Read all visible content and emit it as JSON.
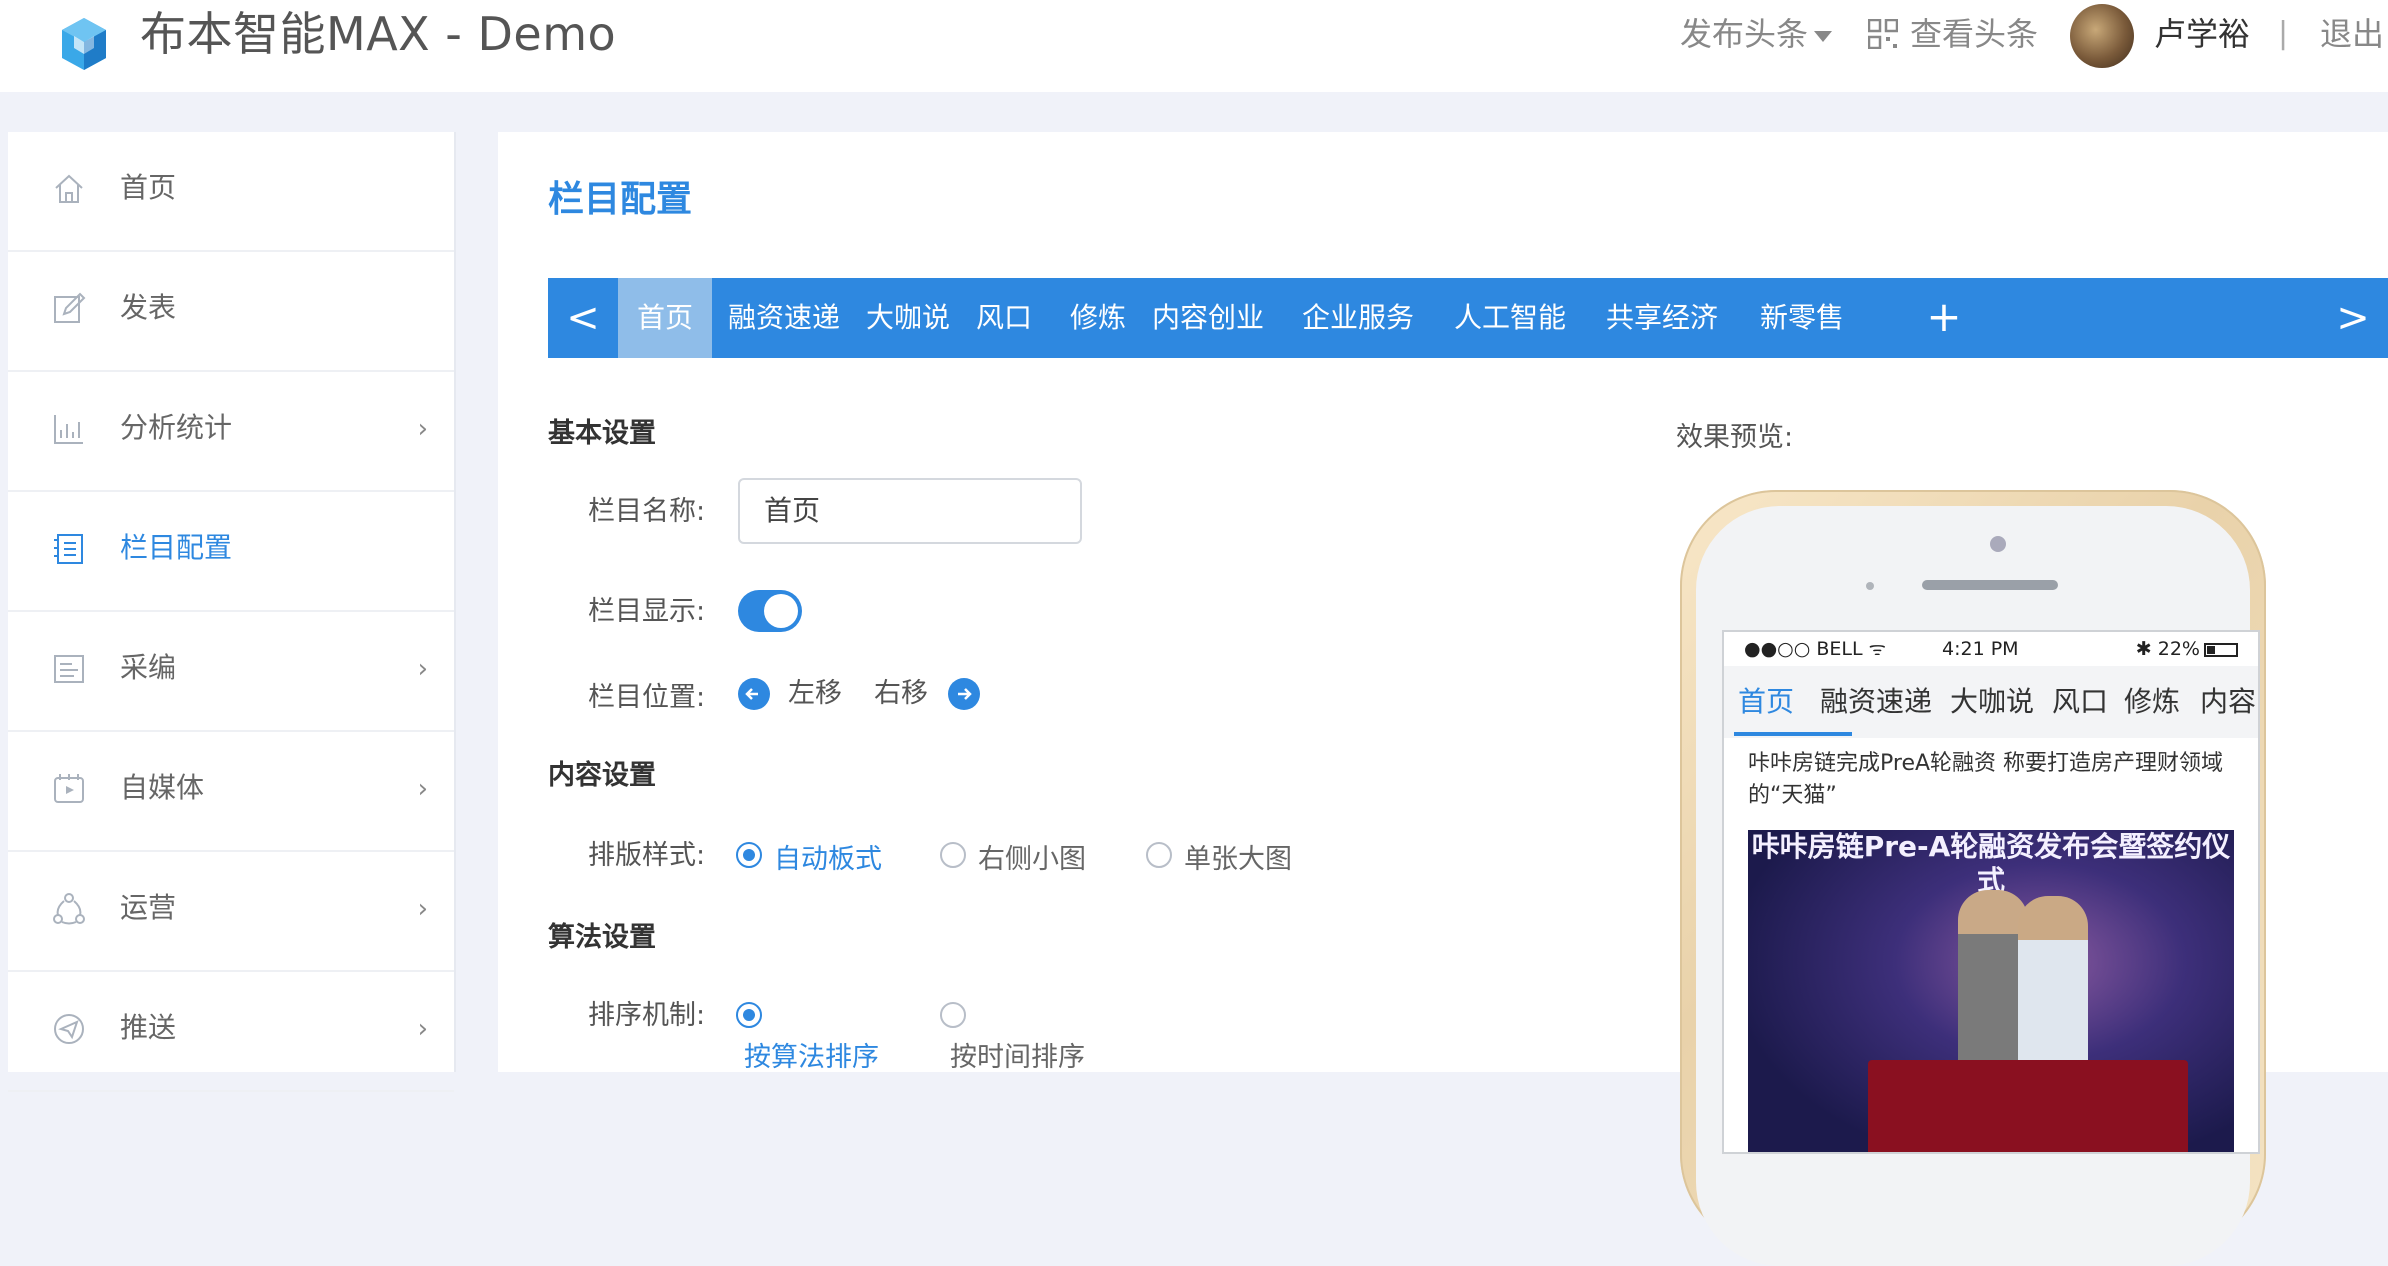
{
  "header": {
    "app_title": "布本智能MAX - Demo",
    "publish_label": "发布头条",
    "view_label": "查看头条",
    "user_name": "卢学裕",
    "separator": "|",
    "logout_label": "退出"
  },
  "sidebar": {
    "items": [
      {
        "label": "首页",
        "icon": "home-icon",
        "arrow": ""
      },
      {
        "label": "发表",
        "icon": "edit-icon",
        "arrow": ""
      },
      {
        "label": "分析统计",
        "icon": "chart-icon",
        "arrow": "›"
      },
      {
        "label": "栏目配置",
        "icon": "list-icon",
        "arrow": ""
      },
      {
        "label": "采编",
        "icon": "collect-icon",
        "arrow": "›"
      },
      {
        "label": "自媒体",
        "icon": "media-icon",
        "arrow": "›"
      },
      {
        "label": "运营",
        "icon": "share-icon",
        "arrow": "›"
      },
      {
        "label": "推送",
        "icon": "send-icon",
        "arrow": "›"
      }
    ]
  },
  "main": {
    "page_title": "栏目配置",
    "tabs": {
      "prev": "<",
      "next": ">",
      "add": "+",
      "items": [
        "首页",
        "融资速递",
        "大咖说",
        "风口",
        "修炼",
        "内容创业",
        "企业服务",
        "人工智能",
        "共享经济",
        "新零售"
      ]
    },
    "basic": {
      "title": "基本设置",
      "name_label": "栏目名称:",
      "name_value": "首页",
      "display_label": "栏目显示:",
      "position_label": "栏目位置:",
      "move_left": "左移",
      "move_right": "右移"
    },
    "content": {
      "title": "内容设置",
      "layout_label": "排版样式:",
      "options": [
        "自动板式",
        "右侧小图",
        "单张大图"
      ]
    },
    "algorithm": {
      "title": "算法设置",
      "sort_label": "排序机制:",
      "options": [
        "按算法排序",
        "按时间排序"
      ]
    },
    "preview": {
      "label": "效果预览:",
      "status_left": "●●○○ BELL ᯤ",
      "status_time": "4:21 PM",
      "status_right": "✱ 22%",
      "tabs": [
        "首页",
        "融资速递",
        "大咖说",
        "风口",
        "修炼",
        "内容"
      ],
      "headline": "咔咔房链完成PreA轮融资 称要打造房产理财领域的“天猫”",
      "image_text": "咔咔房链Pre-A轮融资发布会暨签约仪式"
    }
  },
  "colors": {
    "accent": "#2e88e0",
    "tab_active": "#8fbde9",
    "background": "#f0f2f9"
  }
}
